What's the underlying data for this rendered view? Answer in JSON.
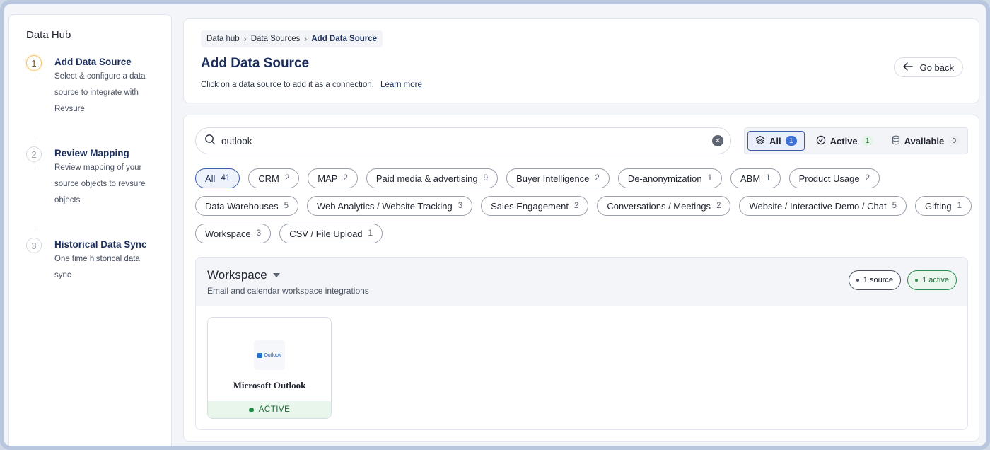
{
  "sidebar": {
    "title": "Data Hub",
    "steps": [
      {
        "num": "1",
        "title": "Add Data Source",
        "desc_lines": [
          "Select & configure a data",
          "source to integrate with",
          "Revsure"
        ]
      },
      {
        "num": "2",
        "title": "Review Mapping",
        "desc_lines": [
          "Review mapping of your",
          "source objects to revsure",
          "objects"
        ]
      },
      {
        "num": "3",
        "title": "Historical Data Sync",
        "desc_lines": [
          "One time historical data sync"
        ]
      }
    ]
  },
  "breadcrumb": [
    "Data hub",
    "Data Sources",
    "Add Data Source"
  ],
  "header": {
    "title": "Add Data Source",
    "subtitle": "Click on a data source to add it as a connection.",
    "learn_more": "Learn more",
    "go_back": "Go back"
  },
  "search": {
    "value": "outlook",
    "placeholder": "Search"
  },
  "status_filter": [
    {
      "label": "All",
      "count": "1",
      "selected": true
    },
    {
      "label": "Active",
      "count": "1",
      "selected": false
    },
    {
      "label": "Available",
      "count": "0",
      "selected": false
    }
  ],
  "categories": [
    {
      "label": "All",
      "count": "41"
    },
    {
      "label": "CRM",
      "count": "2"
    },
    {
      "label": "MAP",
      "count": "2"
    },
    {
      "label": "Paid media & advertising",
      "count": "9"
    },
    {
      "label": "Buyer Intelligence",
      "count": "2"
    },
    {
      "label": "De-anonymization",
      "count": "1"
    },
    {
      "label": "ABM",
      "count": "1"
    },
    {
      "label": "Product Usage",
      "count": "2"
    },
    {
      "label": "Data Warehouses",
      "count": "5"
    },
    {
      "label": "Web Analytics / Website Tracking",
      "count": "3"
    },
    {
      "label": "Sales Engagement",
      "count": "2"
    },
    {
      "label": "Conversations / Meetings",
      "count": "2"
    },
    {
      "label": "Website / Interactive Demo / Chat",
      "count": "5"
    },
    {
      "label": "Gifting",
      "count": "1"
    },
    {
      "label": "Workspace",
      "count": "3"
    },
    {
      "label": "CSV / File Upload",
      "count": "1"
    }
  ],
  "group": {
    "title": "Workspace",
    "desc": "Email and calendar workspace integrations",
    "source_pill": "1 source",
    "active_pill": "1 active",
    "card": {
      "logo_text": "Outlook",
      "name": "Microsoft Outlook",
      "status": "ACTIVE"
    }
  },
  "colors": {
    "accent": "#1c2f5c",
    "active_green": "#1f8a44",
    "selected_blue": "#3d6fd8"
  }
}
